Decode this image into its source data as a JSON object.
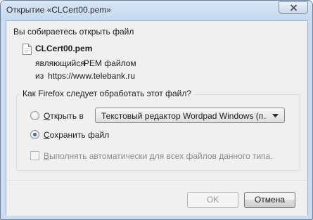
{
  "window": {
    "title": "Открытие «CLCert00.pem»"
  },
  "intro": "Вы собираетесь открыть файл",
  "file": {
    "name": "CLCert00.pem",
    "type_prefix": "являющийся",
    "type_value": "PEM файлом",
    "from_prefix": "из",
    "from_value": "https://www.telebank.ru"
  },
  "action_group": {
    "question": "Как Firefox следует обработать этот файл?",
    "open_with_label": "Открыть в",
    "open_with_selected": "Текстовый редактор Wordpad Windows (п...",
    "save_label": "Сохранить файл",
    "selected_option": "save",
    "auto_label": "Выполнять автоматически для всех файлов данного типа.",
    "auto_checked": false
  },
  "buttons": {
    "ok": "OK",
    "cancel": "Отмена"
  },
  "icons": {
    "close": "close-icon",
    "file": "file-icon",
    "dropdown": "chevron-down-icon"
  }
}
